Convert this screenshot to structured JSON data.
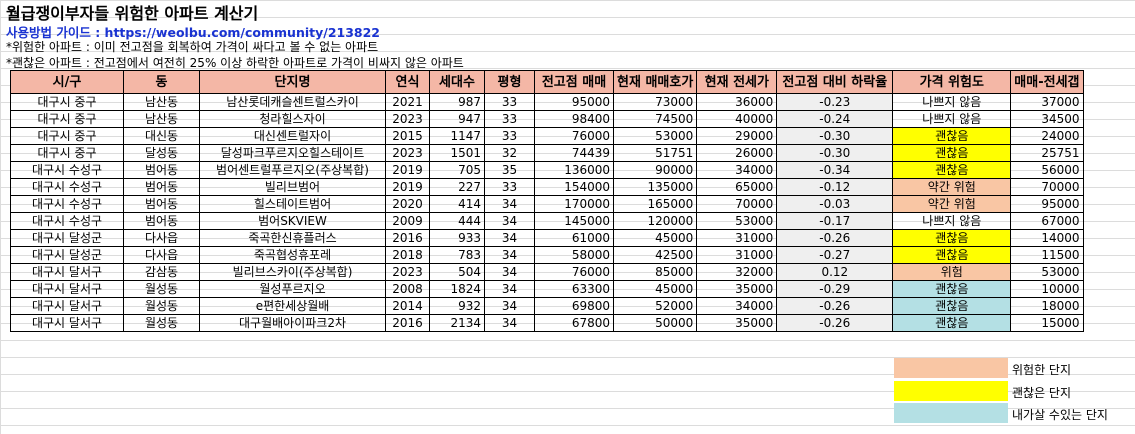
{
  "title": "월급쟁이부자들 위험한 아파트 계산기",
  "guide": "사용방법 가이드 : https://weolbu.com/community/213822",
  "notes": [
    "*위험한 아파트 : 이미 전고점을 회복하여 가격이 싸다고 볼 수 없는 아파트",
    "*괜찮은 아파트 : 전고점에서 여전히 25% 이상 하락한 아파트로 가격이 비싸지 않은 아파트"
  ],
  "columns": [
    "시/구",
    "동",
    "단지명",
    "연식",
    "세대수",
    "평형",
    "전고점 매매",
    "현재 매매호가",
    "현재 전세가",
    "전고점 대비 하락율",
    "가격 위험도",
    "매매-전세갭"
  ],
  "colors": {
    "header": "#f4b7a6",
    "risky": "#f9c6a4",
    "ok": "#ffff00",
    "buyable": "#b4e0e4",
    "ratio_cell": "#efefef"
  },
  "rows": [
    {
      "city": "대구시 중구",
      "dong": "남산동",
      "name": "남산롯데캐슬센트럴스카이",
      "year": "2021",
      "units": "987",
      "size": "33",
      "peak": "95000",
      "price": "73000",
      "jeonse": "36000",
      "drop": "-0.23",
      "risk": "나쁘지 않음",
      "risk_level": "none",
      "gap": "37000"
    },
    {
      "city": "대구시 중구",
      "dong": "남산동",
      "name": "청라힐스자이",
      "year": "2023",
      "units": "947",
      "size": "33",
      "peak": "98400",
      "price": "74500",
      "jeonse": "40000",
      "drop": "-0.24",
      "risk": "나쁘지 않음",
      "risk_level": "none",
      "gap": "34500"
    },
    {
      "city": "대구시 중구",
      "dong": "대신동",
      "name": "대신센트럴자이",
      "year": "2015",
      "units": "1147",
      "size": "33",
      "peak": "76000",
      "price": "53000",
      "jeonse": "29000",
      "drop": "-0.30",
      "risk": "괜찮음",
      "risk_level": "ok",
      "gap": "24000"
    },
    {
      "city": "대구시 중구",
      "dong": "달성동",
      "name": "달성파크푸르지오힐스테이트",
      "year": "2023",
      "units": "1501",
      "size": "32",
      "peak": "74439",
      "price": "51751",
      "jeonse": "26000",
      "drop": "-0.30",
      "risk": "괜찮음",
      "risk_level": "ok",
      "gap": "25751"
    },
    {
      "city": "대구시 수성구",
      "dong": "범어동",
      "name": "범어센트럴푸르지오(주상복합)",
      "year": "2019",
      "units": "705",
      "size": "35",
      "peak": "136000",
      "price": "90000",
      "jeonse": "34000",
      "drop": "-0.34",
      "risk": "괜찮음",
      "risk_level": "ok",
      "gap": "56000"
    },
    {
      "city": "대구시 수성구",
      "dong": "범어동",
      "name": "빌리브범어",
      "year": "2019",
      "units": "227",
      "size": "33",
      "peak": "154000",
      "price": "135000",
      "jeonse": "65000",
      "drop": "-0.12",
      "risk": "약간 위험",
      "risk_level": "risky",
      "gap": "70000"
    },
    {
      "city": "대구시 수성구",
      "dong": "범어동",
      "name": "힐스테이트범어",
      "year": "2020",
      "units": "414",
      "size": "34",
      "peak": "170000",
      "price": "165000",
      "jeonse": "70000",
      "drop": "-0.03",
      "risk": "약간 위험",
      "risk_level": "risky",
      "gap": "95000"
    },
    {
      "city": "대구시 수성구",
      "dong": "범어동",
      "name": "범어SKVIEW",
      "year": "2009",
      "units": "444",
      "size": "34",
      "peak": "145000",
      "price": "120000",
      "jeonse": "53000",
      "drop": "-0.17",
      "risk": "나쁘지 않음",
      "risk_level": "none",
      "gap": "67000"
    },
    {
      "city": "대구시 달성군",
      "dong": "다사읍",
      "name": "죽곡한신휴플러스",
      "year": "2016",
      "units": "933",
      "size": "34",
      "peak": "61000",
      "price": "45000",
      "jeonse": "31000",
      "drop": "-0.26",
      "risk": "괜찮음",
      "risk_level": "ok",
      "gap": "14000"
    },
    {
      "city": "대구시 달성군",
      "dong": "다사읍",
      "name": "죽곡협성휴포레",
      "year": "2018",
      "units": "783",
      "size": "34",
      "peak": "58000",
      "price": "42500",
      "jeonse": "31000",
      "drop": "-0.27",
      "risk": "괜찮음",
      "risk_level": "ok",
      "gap": "11500"
    },
    {
      "city": "대구시 달서구",
      "dong": "감삼동",
      "name": "빌리브스카이(주상복합)",
      "year": "2023",
      "units": "504",
      "size": "34",
      "peak": "76000",
      "price": "85000",
      "jeonse": "32000",
      "drop": "0.12",
      "risk": "위험",
      "risk_level": "risky",
      "gap": "53000"
    },
    {
      "city": "대구시 달서구",
      "dong": "월성동",
      "name": "월성푸르지오",
      "year": "2008",
      "units": "1824",
      "size": "34",
      "peak": "63300",
      "price": "45000",
      "jeonse": "35000",
      "drop": "-0.29",
      "risk": "괜찮음",
      "risk_level": "buyable",
      "gap": "10000"
    },
    {
      "city": "대구시 달서구",
      "dong": "월성동",
      "name": "e편한세상월배",
      "year": "2014",
      "units": "932",
      "size": "34",
      "peak": "69800",
      "price": "52000",
      "jeonse": "34000",
      "drop": "-0.26",
      "risk": "괜찮음",
      "risk_level": "buyable",
      "gap": "18000"
    },
    {
      "city": "대구시 달서구",
      "dong": "월성동",
      "name": "대구월배아이파크2차",
      "year": "2016",
      "units": "2134",
      "size": "34",
      "peak": "67800",
      "price": "50000",
      "jeonse": "35000",
      "drop": "-0.26",
      "risk": "괜찮음",
      "risk_level": "buyable",
      "gap": "15000"
    }
  ],
  "legend": [
    {
      "label": "위험한 단지",
      "level": "risky"
    },
    {
      "label": "괜찮은 단지",
      "level": "ok"
    },
    {
      "label": "내가살 수있는 단지",
      "level": "buyable"
    }
  ]
}
